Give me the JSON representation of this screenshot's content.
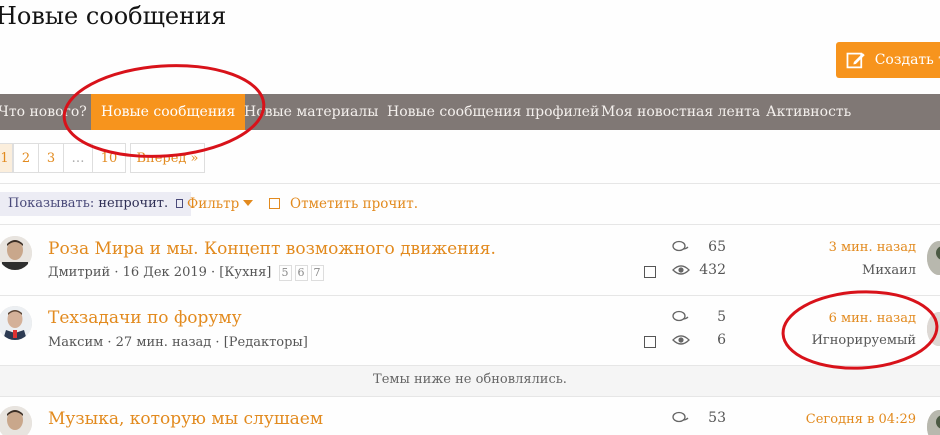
{
  "page_title": "Новые сообщения",
  "create_button": {
    "label": "Создать т"
  },
  "nav": {
    "items": [
      {
        "label": "Что нового?"
      },
      {
        "label": "Новые сообщения",
        "active": true
      },
      {
        "label": "Новые материалы"
      },
      {
        "label": "Новые сообщения профилей"
      },
      {
        "label": "Моя новостная лента"
      },
      {
        "label": "Активность"
      }
    ]
  },
  "pager": {
    "pages": [
      "1",
      "2",
      "3",
      "…",
      "10"
    ],
    "current": "1",
    "next_label": "Вперед"
  },
  "filter_bar": {
    "show_label": "Показывать:",
    "show_value": "непрочит.",
    "filter_label": "Фильтр",
    "mark_read_label": "Отметить прочит."
  },
  "threads": [
    {
      "title": "Роза Мира и мы. Концепт возможного движения.",
      "author": "Дмитрий",
      "date": "16 Дек 2019",
      "forum": "[Кухня]",
      "pages": [
        "5",
        "6",
        "7"
      ],
      "replies": "65",
      "views": "432",
      "last_time": "3 мин. назад",
      "last_user": "Михаил"
    },
    {
      "title": "Техзадачи по форуму",
      "author": "Максим",
      "date": "27 мин. назад",
      "forum": "[Редакторы]",
      "pages": [],
      "replies": "5",
      "views": "6",
      "last_time": "6 мин. назад",
      "last_user": "Игнорируемый"
    },
    {
      "title": "Музыка, которую мы слушаем",
      "replies": "53",
      "last_time": "Сегодня в 04:29"
    }
  ],
  "separator_text": "Темы ниже не обновлялись.",
  "colors": {
    "accent": "#f7941d",
    "nav_bg": "#807875",
    "link": "#e28a1e",
    "annotation": "#d8121a"
  }
}
